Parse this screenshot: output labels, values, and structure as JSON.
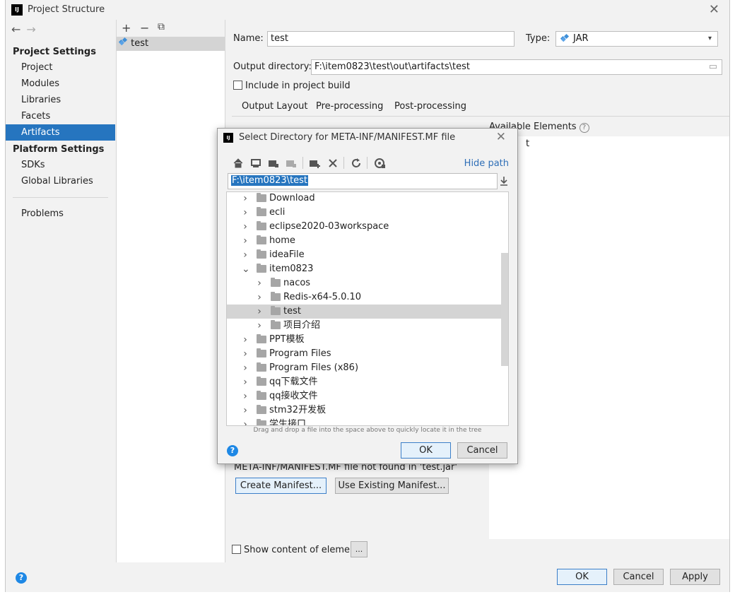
{
  "window": {
    "title": "Project Structure",
    "app_icon": "IJ"
  },
  "nav": {
    "back": "←",
    "forward": "→"
  },
  "sidebar": {
    "project_settings": "Project Settings",
    "items_project": [
      "Project",
      "Modules",
      "Libraries",
      "Facets",
      "Artifacts"
    ],
    "selected": "Artifacts",
    "platform_settings": "Platform Settings",
    "items_platform": [
      "SDKs",
      "Global Libraries"
    ],
    "problems": "Problems"
  },
  "artifacts_list": {
    "toolbar": {
      "add": "+",
      "remove": "−",
      "copy": "⧉"
    },
    "items": [
      "test"
    ]
  },
  "artifact": {
    "name_label": "Name:",
    "name_value": "test",
    "type_label": "Type:",
    "type_value": "JAR",
    "output_label": "Output directory:",
    "output_value": "F:\\item0823\\test\\out\\artifacts\\test",
    "include_build": "Include in project build",
    "tabs": [
      "Output Layout",
      "Pre-processing",
      "Post-processing"
    ],
    "active_tab": "Output Layout",
    "available_elements": "Available Elements",
    "available_fragment": "t",
    "manifest_warning": "META-INF/MANIFEST.MF file not found in 'test.jar'",
    "create_manifest": "Create Manifest...",
    "use_existing": "Use Existing Manifest...",
    "show_content": "Show content of elements",
    "more_btn": "..."
  },
  "footer": {
    "ok": "OK",
    "cancel": "Cancel",
    "apply": "Apply",
    "help": "?"
  },
  "dialog": {
    "title": "Select Directory for META-INF/MANIFEST.MF file",
    "hide_path": "Hide path",
    "path_value": "F:\\item0823\\test",
    "tree": [
      {
        "name": "Download",
        "depth": 0,
        "expanded": false,
        "selected": false
      },
      {
        "name": "ecli",
        "depth": 0,
        "expanded": false,
        "selected": false
      },
      {
        "name": "eclipse2020-03workspace",
        "depth": 0,
        "expanded": false,
        "selected": false
      },
      {
        "name": "home",
        "depth": 0,
        "expanded": false,
        "selected": false
      },
      {
        "name": "ideaFile",
        "depth": 0,
        "expanded": false,
        "selected": false
      },
      {
        "name": "item0823",
        "depth": 0,
        "expanded": true,
        "selected": false
      },
      {
        "name": "nacos",
        "depth": 1,
        "expanded": false,
        "selected": false
      },
      {
        "name": "Redis-x64-5.0.10",
        "depth": 1,
        "expanded": false,
        "selected": false
      },
      {
        "name": "test",
        "depth": 1,
        "expanded": false,
        "selected": true
      },
      {
        "name": "项目介绍",
        "depth": 1,
        "expanded": false,
        "selected": false
      },
      {
        "name": "PPT模板",
        "depth": 0,
        "expanded": false,
        "selected": false
      },
      {
        "name": "Program Files",
        "depth": 0,
        "expanded": false,
        "selected": false
      },
      {
        "name": "Program Files (x86)",
        "depth": 0,
        "expanded": false,
        "selected": false
      },
      {
        "name": "qq下载文件",
        "depth": 0,
        "expanded": false,
        "selected": false
      },
      {
        "name": "qq接收文件",
        "depth": 0,
        "expanded": false,
        "selected": false
      },
      {
        "name": "stm32开发板",
        "depth": 0,
        "expanded": false,
        "selected": false
      },
      {
        "name": "学生接口",
        "depth": 0,
        "expanded": false,
        "selected": false
      }
    ],
    "drag_hint": "Drag and drop a file into the space above to quickly locate it in the tree",
    "ok": "OK",
    "cancel": "Cancel",
    "help": "?"
  }
}
